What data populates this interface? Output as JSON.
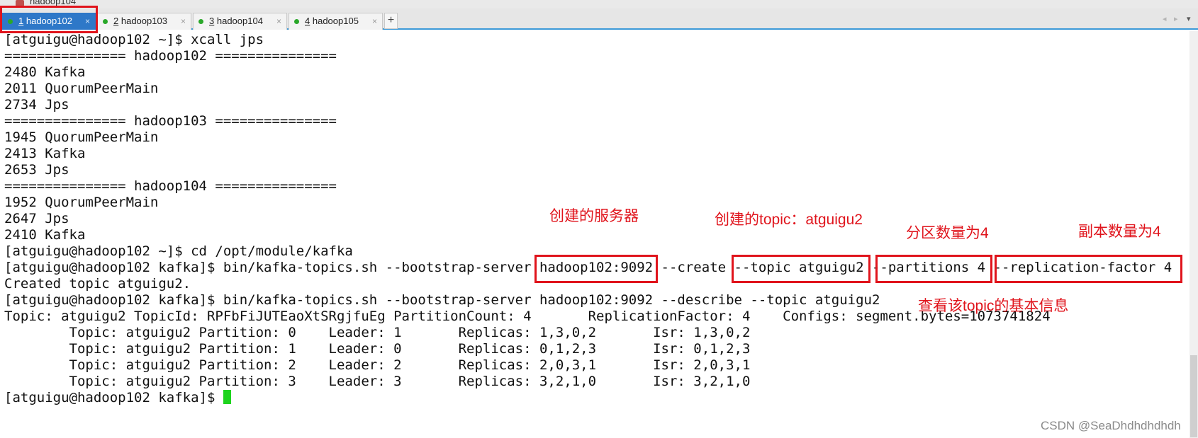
{
  "window": {
    "title": "hadoop104"
  },
  "tabs": [
    {
      "num": "1",
      "name": "hadoop102",
      "close": "×"
    },
    {
      "num": "2",
      "name": "hadoop103",
      "close": "×"
    },
    {
      "num": "3",
      "name": "hadoop104",
      "close": "×"
    },
    {
      "num": "4",
      "name": "hadoop105",
      "close": "×"
    }
  ],
  "tab_add": "+",
  "tab_nav": {
    "prev": "◂",
    "next": "▸",
    "menu": "▾"
  },
  "terminal": {
    "lines": [
      "[atguigu@hadoop102 ~]$ xcall jps",
      "=============== hadoop102 ===============",
      "2480 Kafka",
      "2011 QuorumPeerMain",
      "2734 Jps",
      "=============== hadoop103 ===============",
      "1945 QuorumPeerMain",
      "2413 Kafka",
      "2653 Jps",
      "=============== hadoop104 ===============",
      "1952 QuorumPeerMain",
      "2647 Jps",
      "2410 Kafka",
      "[atguigu@hadoop102 ~]$ cd /opt/module/kafka",
      "[atguigu@hadoop102 kafka]$ bin/kafka-topics.sh --bootstrap-server hadoop102:9092 --create --topic atguigu2 --partitions 4 --replication-factor 4",
      "Created topic atguigu2.",
      "[atguigu@hadoop102 kafka]$ bin/kafka-topics.sh --bootstrap-server hadoop102:9092 --describe --topic atguigu2",
      "Topic: atguigu2 TopicId: RPFbFiJUTEaoXtSRgjfuEg PartitionCount: 4       ReplicationFactor: 4    Configs: segment.bytes=1073741824",
      "        Topic: atguigu2 Partition: 0    Leader: 1       Replicas: 1,3,0,2       Isr: 1,3,0,2",
      "        Topic: atguigu2 Partition: 1    Leader: 0       Replicas: 0,1,2,3       Isr: 0,1,2,3",
      "        Topic: atguigu2 Partition: 2    Leader: 2       Replicas: 2,0,3,1       Isr: 2,0,3,1",
      "        Topic: atguigu2 Partition: 3    Leader: 3       Replicas: 3,2,1,0       Isr: 3,2,1,0"
    ],
    "prompt": "[atguigu@hadoop102 kafka]$ "
  },
  "annotations": {
    "server": "创建的服务器",
    "topic": "创建的topic：atguigu2",
    "partitions": "分区数量为4",
    "replicas": "副本数量为4",
    "describe": "查看该topic的基本信息"
  },
  "colors": {
    "highlight": "#e0141c",
    "cursor": "#1ed41e",
    "active_tab": "#2e78c8"
  },
  "watermark": "CSDN @SeaDhdhdhdhdh"
}
